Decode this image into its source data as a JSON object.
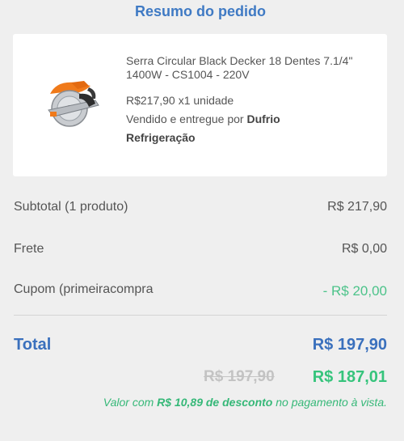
{
  "header": {
    "title": "Resumo do pedido"
  },
  "product": {
    "name": "Serra Circular Black Decker 18 Dentes 7.1/4\" 1400W - CS1004 - 220V",
    "price": "R$217,90",
    "quantity": "x1 unidade",
    "seller_prefix": "Vendido e entregue por",
    "seller_name": "Dufrio Refrigeração",
    "image_icon": "circular-saw-image"
  },
  "summary": {
    "subtotal_label": "Subtotal (1 produto)",
    "subtotal_value": "R$ 217,90",
    "shipping_label": "Frete",
    "shipping_value": "R$ 0,00",
    "coupon_label": "Cupom (primeiracompra",
    "coupon_value": "- R$ 20,00",
    "total_label": "Total",
    "total_value": "R$ 197,90",
    "old_price": "R$ 197,90",
    "discounted_price": "R$ 187,01",
    "note_prefix": "Valor com",
    "note_discount": "R$ 10,89 de desconto",
    "note_suffix": "no pagamento à vista."
  },
  "colors": {
    "background": "#efefef",
    "accent_blue": "#3a70bd",
    "accent_green": "#36c47c",
    "text": "#555555"
  }
}
